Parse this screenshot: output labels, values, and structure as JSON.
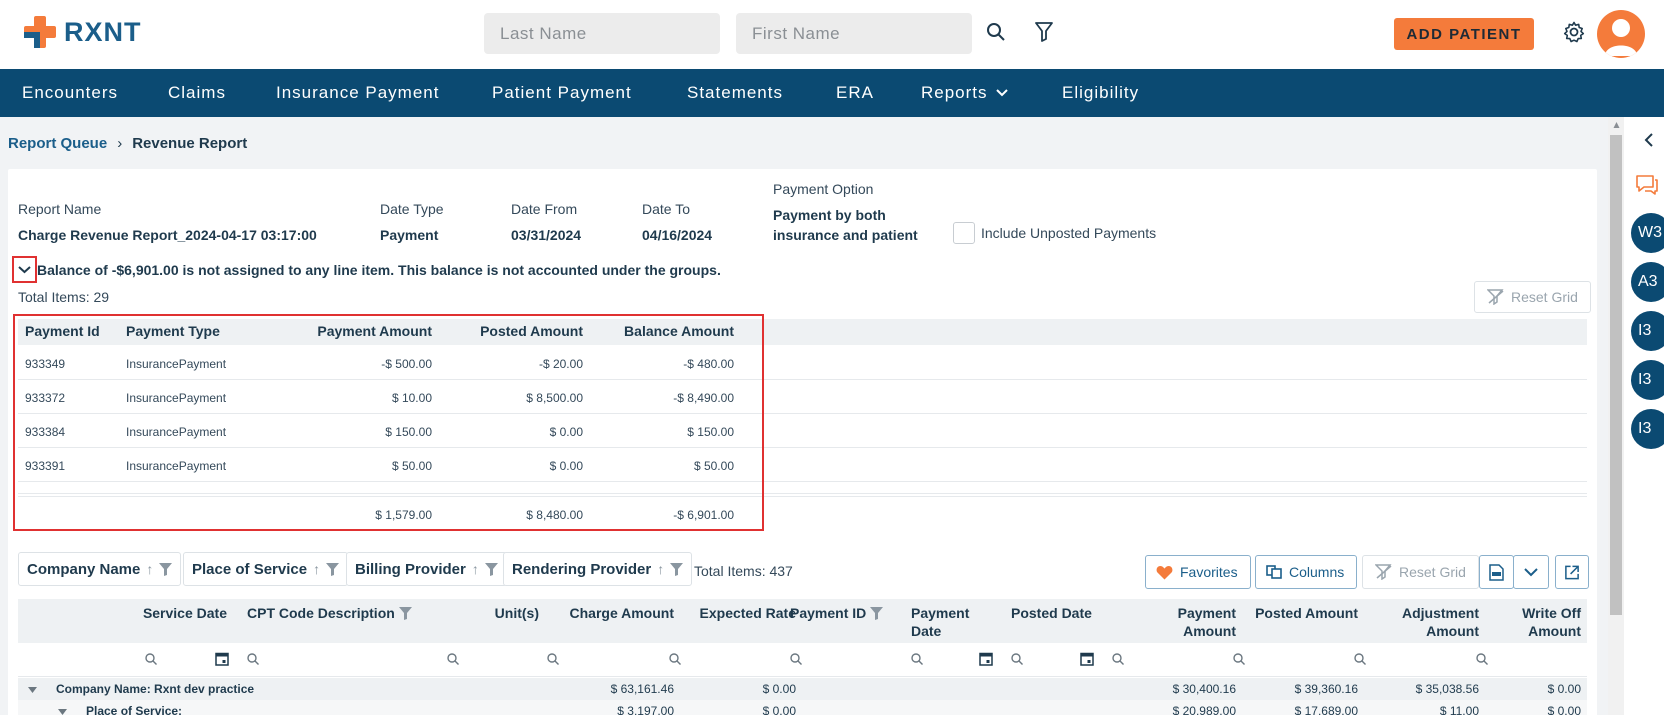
{
  "brand": {
    "name": "RXNT"
  },
  "search": {
    "last_name_placeholder": "Last Name",
    "first_name_placeholder": "First Name"
  },
  "header": {
    "add_patient_label": "ADD PATIENT"
  },
  "nav": [
    {
      "label": "Encounters"
    },
    {
      "label": "Claims"
    },
    {
      "label": "Insurance Payment"
    },
    {
      "label": "Patient Payment"
    },
    {
      "label": "Statements"
    },
    {
      "label": "ERA"
    },
    {
      "label": "Reports"
    },
    {
      "label": "Eligibility"
    }
  ],
  "breadcrumb": {
    "parent": "Report Queue",
    "separator": "›",
    "current": "Revenue Report"
  },
  "report": {
    "name_label": "Report Name",
    "name_value": "Charge Revenue Report_2024-04-17 03:17:00",
    "date_type_label": "Date Type",
    "date_type_value": "Payment",
    "date_from_label": "Date From",
    "date_from_value": "03/31/2024",
    "date_to_label": "Date To",
    "date_to_value": "04/16/2024",
    "payment_option_label": "Payment Option",
    "payment_option_line1": "Payment by both",
    "payment_option_line2": "insurance and patient",
    "include_unposted_label": "Include Unposted Payments"
  },
  "balance_message": "Balance of -$6,901.00 is not assigned to any line item. This balance is not accounted under the groups.",
  "payments": {
    "total_items": "Total Items: 29",
    "reset_label": "Reset Grid",
    "columns": [
      "Payment Id",
      "Payment Type",
      "Payment Amount",
      "Posted Amount",
      "Balance Amount"
    ],
    "rows": [
      [
        "933349",
        "InsurancePayment",
        "-$ 500.00",
        "-$ 20.00",
        "-$ 480.00"
      ],
      [
        "933372",
        "InsurancePayment",
        "$ 10.00",
        "$ 8,500.00",
        "-$ 8,490.00"
      ],
      [
        "933384",
        "InsurancePayment",
        "$ 150.00",
        "$ 0.00",
        "$ 150.00"
      ],
      [
        "933391",
        "InsurancePayment",
        "$ 50.00",
        "$ 0.00",
        "$ 50.00"
      ]
    ],
    "totals": [
      "$ 1,579.00",
      "$ 8,480.00",
      "-$ 6,901.00"
    ]
  },
  "grid": {
    "group_chips": [
      "Company Name",
      "Place of Service",
      "Billing Provider",
      "Rendering Provider"
    ],
    "total_items": "Total Items: 437",
    "favorites_label": "Favorites",
    "columns_label": "Columns",
    "reset_label": "Reset Grid",
    "headers": {
      "service_date": "Service Date",
      "cpt": "CPT Code Description",
      "units": "Unit(s)",
      "charge": "Charge Amount",
      "expected": "Expected Rate",
      "payment_id": "Payment ID",
      "payment_date_1": "Payment",
      "payment_date_2": "Date",
      "posted_date": "Posted Date",
      "payment_amount_1": "Payment",
      "payment_amount_2": "Amount",
      "posted_amount": "Posted Amount",
      "adjustment_1": "Adjustment",
      "adjustment_2": "Amount",
      "writeoff_1": "Write Off",
      "writeoff_2": "Amount"
    },
    "group_rows": [
      {
        "label": "Company Name: Rxnt dev practice",
        "charge": "$ 63,161.46",
        "expected": "$ 0.00",
        "payment_amount": "$ 30,400.16",
        "posted_amount": "$ 39,360.16",
        "adjustment": "$ 35,038.56",
        "writeoff": "$ 0.00"
      },
      {
        "label": "Place of Service:",
        "charge": "$ 3,197.00",
        "expected": "$ 0.00",
        "payment_amount": "$ 20,989.00",
        "posted_amount": "$ 17,689.00",
        "adjustment": "$ 11.00",
        "writeoff": "$ 0.00"
      }
    ]
  },
  "right_rail": {
    "bubbles": [
      "W3",
      "A3",
      "I3",
      "I3",
      "I3"
    ]
  },
  "colors": {
    "brand_blue": "#0b4a72",
    "accent_orange": "#f47b3b",
    "highlight_red": "#e03131"
  }
}
